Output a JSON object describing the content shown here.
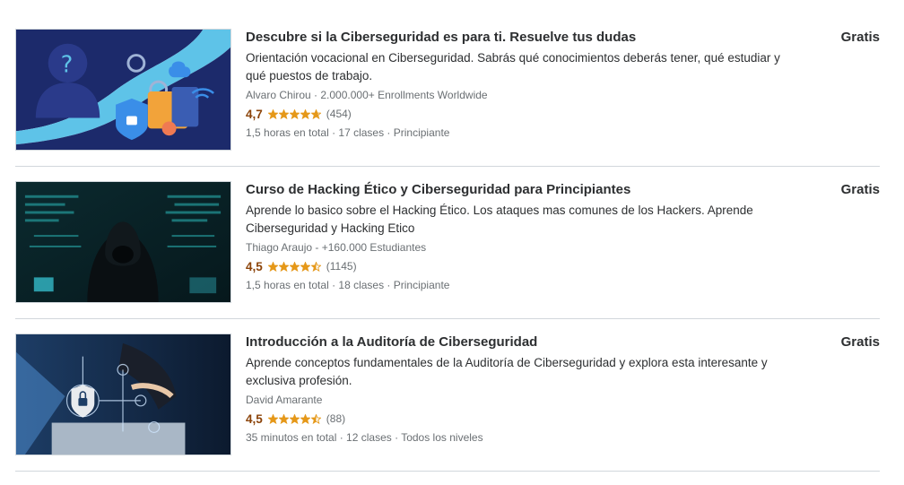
{
  "colors": {
    "rating": "#8b4309",
    "star": "#e59819",
    "text": "#2d2f31",
    "muted": "#6a6f73",
    "divider": "#d1d7dc"
  },
  "courses": [
    {
      "title": "Descubre si la Ciberseguridad es para ti. Resuelve tus dudas",
      "description": "Orientación vocacional en Ciberseguridad. Sabrás qué conocimientos deberás tener, qué estudiar y qué puestos de trabajo.",
      "instructor": "Alvaro Chirou · 2.000.000+ Enrollments Worldwide",
      "rating": "4,7",
      "rating_value": 4.7,
      "count": "(454)",
      "meta": "1,5 horas en total · 17 clases · Principiante",
      "price": "Gratis",
      "image_icon": "person-security-illustration"
    },
    {
      "title": "Curso de Hacking Ético y Ciberseguridad para Principiantes",
      "description": "Aprende lo basico sobre el Hacking Ético. Los ataques mas comunes de los Hackers. Aprende Ciberseguridad y Hacking Etico",
      "instructor": "Thiago Araujo - +160.000 Estudiantes",
      "rating": "4,5",
      "rating_value": 4.5,
      "count": "(1145)",
      "meta": "1,5 horas en total · 18 clases · Principiante",
      "price": "Gratis",
      "image_icon": "hooded-hacker-photo"
    },
    {
      "title": "Introducción a la Auditoría de Ciberseguridad",
      "description": "Aprende conceptos fundamentales de la Auditoría de Ciberseguridad y explora esta interesante y exclusiva profesión.",
      "instructor": "David Amarante",
      "rating": "4,5",
      "rating_value": 4.5,
      "count": "(88)",
      "meta": "35 minutos en total · 12 clases · Todos los niveles",
      "price": "Gratis",
      "image_icon": "padlock-laptop-photo"
    }
  ]
}
